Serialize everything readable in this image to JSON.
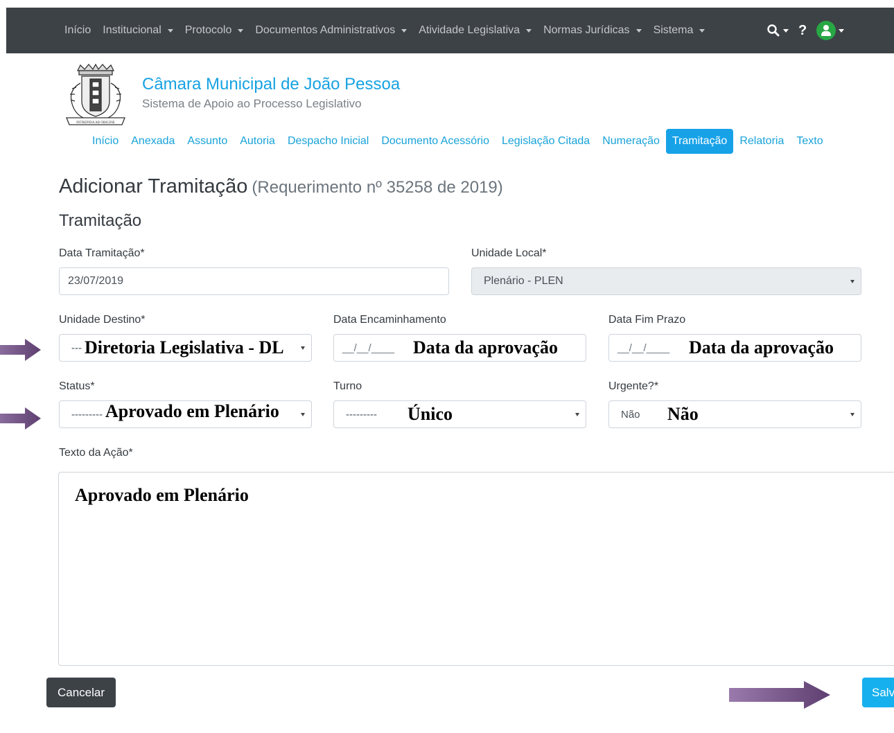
{
  "topnav": {
    "items": [
      {
        "label": "Início",
        "dropdown": false
      },
      {
        "label": "Institucional",
        "dropdown": true
      },
      {
        "label": "Protocolo",
        "dropdown": true
      },
      {
        "label": "Documentos Administrativos",
        "dropdown": true
      },
      {
        "label": "Atividade Legislativa",
        "dropdown": true
      },
      {
        "label": "Normas Jurídicas",
        "dropdown": true
      },
      {
        "label": "Sistema",
        "dropdown": true
      }
    ],
    "tools": {
      "search_icon": "search-icon",
      "help_label": "?",
      "user_icon": "user-icon"
    }
  },
  "header": {
    "title": "Câmara Municipal de João Pessoa",
    "subtitle": "Sistema de Apoio ao Processo Legislativo",
    "logo_motto": "INTREPIDA AB ORIGINE"
  },
  "subnav": {
    "tabs": [
      {
        "label": "Início",
        "active": false
      },
      {
        "label": "Anexada",
        "active": false
      },
      {
        "label": "Assunto",
        "active": false
      },
      {
        "label": "Autoria",
        "active": false
      },
      {
        "label": "Despacho Inicial",
        "active": false
      },
      {
        "label": "Documento Acessório",
        "active": false
      },
      {
        "label": "Legislação Citada",
        "active": false
      },
      {
        "label": "Numeração",
        "active": false
      },
      {
        "label": "Tramitação",
        "active": true
      },
      {
        "label": "Relatoria",
        "active": false
      },
      {
        "label": "Texto",
        "active": false
      }
    ]
  },
  "page": {
    "title": "Adicionar Tramitação",
    "subtitle": "(Requerimento nº 35258 de 2019)",
    "section": "Tramitação"
  },
  "form": {
    "data_tramitacao": {
      "label": "Data Tramitação*",
      "value": "23/07/2019"
    },
    "unidade_local": {
      "label": "Unidade Local*",
      "value": "Plenário - PLEN"
    },
    "unidade_destino": {
      "label": "Unidade Destino*",
      "value": "---",
      "annotation": "Diretoria Legislativa - DL"
    },
    "data_encaminhamento": {
      "label": "Data Encaminhamento",
      "placeholder": "__/__/____",
      "annotation": "Data da aprovação"
    },
    "data_fim_prazo": {
      "label": "Data Fim Prazo",
      "placeholder": "__/__/____",
      "annotation": "Data da aprovação"
    },
    "status": {
      "label": "Status*",
      "value": "---------",
      "annotation": "Aprovado em Plenário"
    },
    "turno": {
      "label": "Turno",
      "value": "---------",
      "annotation": "Único"
    },
    "urgente": {
      "label": "Urgente?*",
      "value": "Não",
      "annotation": "Não"
    },
    "texto_acao": {
      "label": "Texto da Ação*",
      "annotation": "Aprovado em Plenário"
    }
  },
  "buttons": {
    "cancel": "Cancelar",
    "save": "Salvar"
  },
  "colors": {
    "navbar": "#3d4247",
    "accent": "#17a2e8",
    "annotation_arrow": "#6d4d7c"
  }
}
